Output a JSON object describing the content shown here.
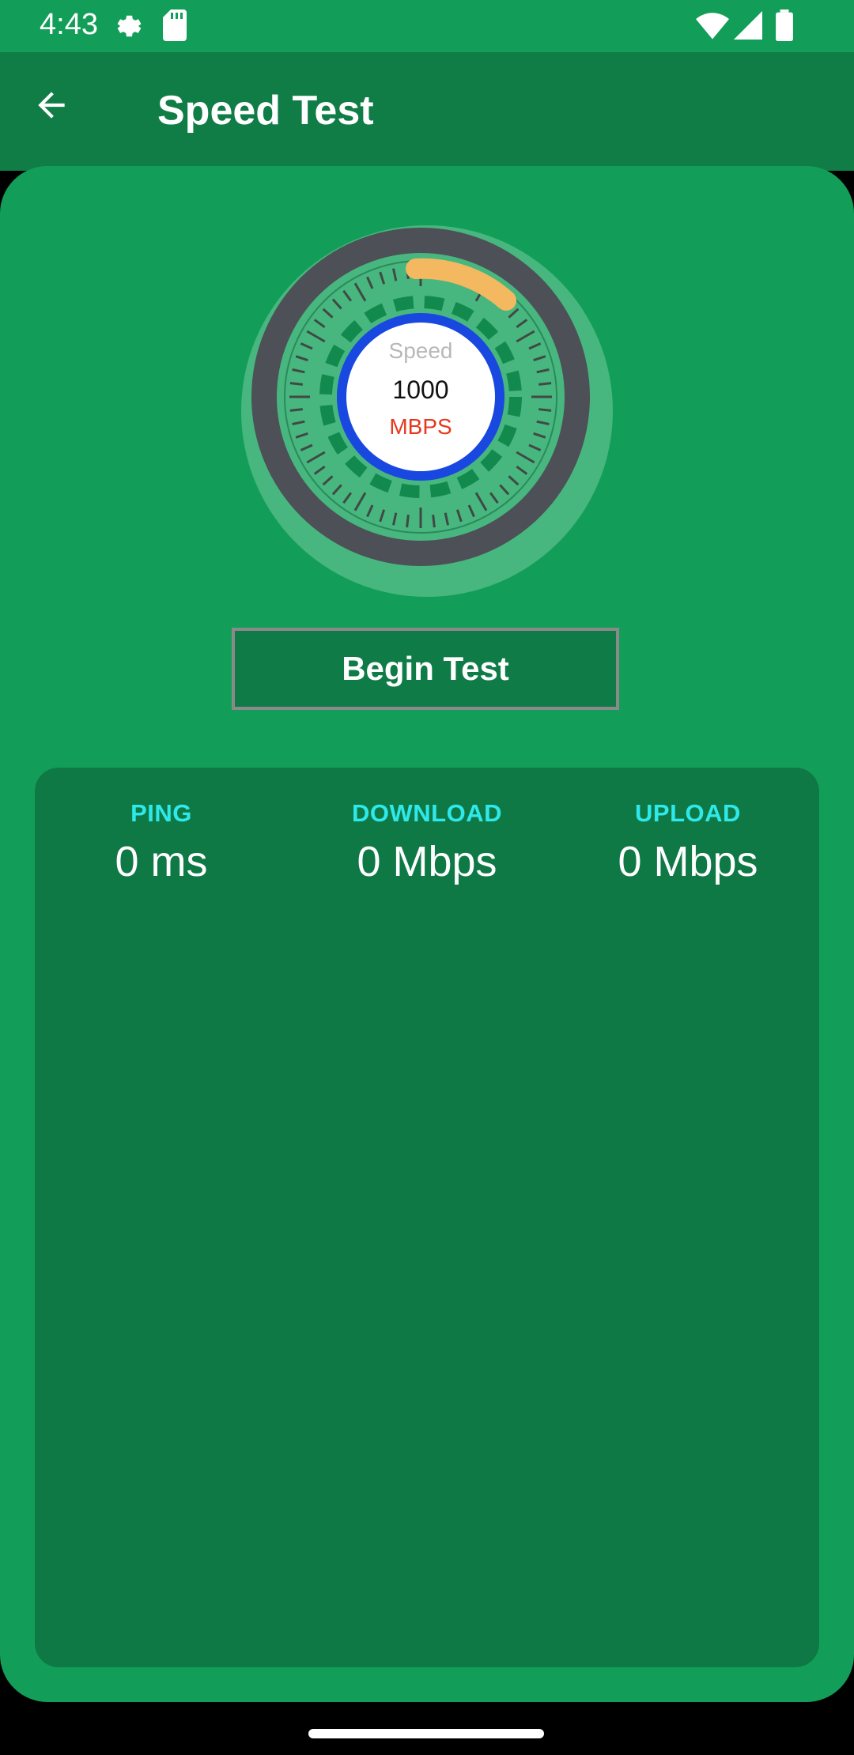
{
  "status_bar": {
    "time": "4:43",
    "icons": [
      "settings-icon",
      "sd-card-icon",
      "wifi-icon",
      "signal-icon",
      "battery-icon"
    ]
  },
  "app_bar": {
    "title": "Speed Test",
    "back_icon": "arrow-back-icon"
  },
  "gauge": {
    "label": "Speed",
    "value": "1000",
    "unit": "MBPS"
  },
  "actions": {
    "begin_label": "Begin Test"
  },
  "results": {
    "ping": {
      "label": "PING",
      "value": "0 ms"
    },
    "download": {
      "label": "DOWNLOAD",
      "value": "0 Mbps"
    },
    "upload": {
      "label": "UPLOAD",
      "value": "0 Mbps"
    }
  },
  "colors": {
    "background": "#129e58",
    "app_bar": "#107d46",
    "panel": "#0f7946",
    "metric_label": "#2ee8ea",
    "gauge_ring": "#4d5056",
    "gauge_arc": "#f4b860",
    "gauge_inner_ring": "#1848e0",
    "unit_text": "#e53a1f"
  }
}
